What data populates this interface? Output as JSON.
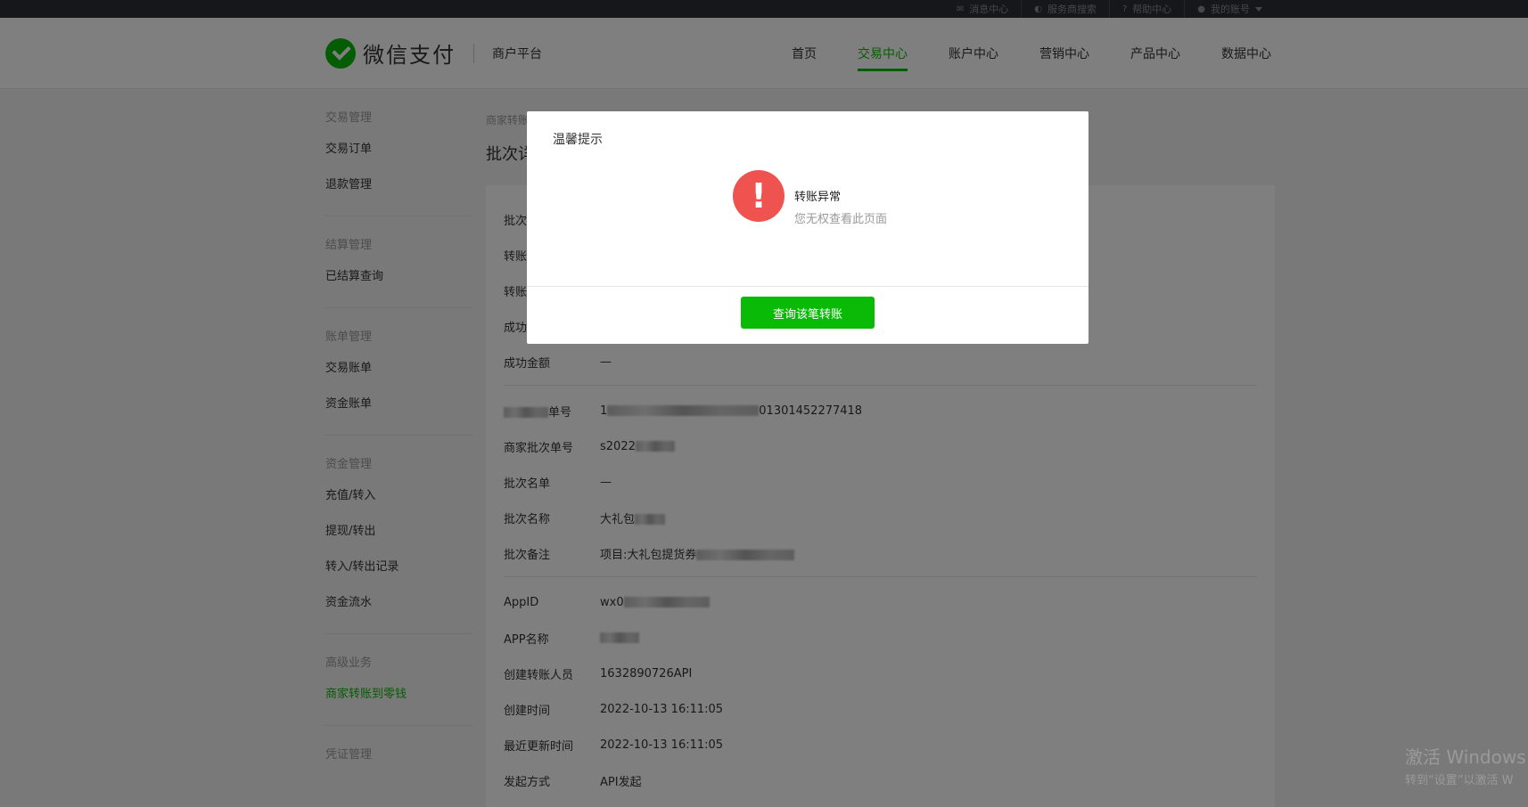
{
  "topbar": {
    "links": [
      {
        "icon": "mail-icon",
        "label": "消息中心"
      },
      {
        "icon": "service-icon",
        "label": "服务商搜索"
      },
      {
        "icon": "help-icon",
        "label": "帮助中心"
      },
      {
        "icon": "user-icon",
        "label": "我的账号"
      }
    ]
  },
  "header": {
    "logo_text": "微信支付",
    "platform": "商户平台",
    "nav": [
      "首页",
      "交易中心",
      "账户中心",
      "营销中心",
      "产品中心",
      "数据中心"
    ],
    "active_nav": "交易中心"
  },
  "sidebar": {
    "groups": [
      {
        "title": "交易管理",
        "items": [
          "交易订单",
          "退款管理"
        ]
      },
      {
        "title": "结算管理",
        "items": [
          "已结算查询"
        ]
      },
      {
        "title": "账单管理",
        "items": [
          "交易账单",
          "资金账单"
        ]
      },
      {
        "title": "资金管理",
        "items": [
          "充值/转入",
          "提现/转出",
          "转入/转出记录",
          "资金流水"
        ]
      },
      {
        "title": "高级业务",
        "items": [
          "商家转账到零钱"
        ]
      },
      {
        "title": "凭证管理",
        "items": []
      }
    ],
    "active_item": "商家转账到零钱"
  },
  "content": {
    "breadcrumb": "商家转账",
    "page_title": "批次详",
    "summary_rows": [
      {
        "label": "批次",
        "value": ""
      },
      {
        "label": "转账",
        "value": ""
      },
      {
        "label": "转账",
        "value": ""
      },
      {
        "label": "成功",
        "value": ""
      },
      {
        "label": "成功金额",
        "value": "—"
      }
    ],
    "batch_rows": [
      {
        "label": "单号",
        "value": "1",
        "value_tail": "01301452277418"
      },
      {
        "label": "商家批次单号",
        "value": "s2022",
        "value_tail": ""
      },
      {
        "label": "批次名单",
        "value": "—",
        "value_tail": ""
      },
      {
        "label": "批次名称",
        "value": "大礼包",
        "value_tail": ""
      },
      {
        "label": "批次备注",
        "value": "项目:大礼包提货券",
        "value_tail": ""
      }
    ],
    "app_rows": [
      {
        "label": "AppID",
        "value": "wx0"
      },
      {
        "label": "APP名称",
        "value": ""
      },
      {
        "label": "创建转账人员",
        "value": "1632890726API"
      },
      {
        "label": "创建时间",
        "value": "2022-10-13 16:11:05"
      },
      {
        "label": "最近更新时间",
        "value": "2022-10-13 16:11:05"
      },
      {
        "label": "发起方式",
        "value": "API发起"
      }
    ]
  },
  "dialog": {
    "title": "温馨提示",
    "icon": "exclamation-icon",
    "alert_title": "转账异常",
    "alert_desc": "您无权查看此页面",
    "button": "查询该笔转账"
  },
  "watermark": {
    "line1": "激活 Windows",
    "line2": "转到“设置”以激活 W"
  },
  "colors": {
    "brand_green": "#09bb07",
    "alert_red": "#ef5350",
    "topbar": "#2b2f36"
  }
}
